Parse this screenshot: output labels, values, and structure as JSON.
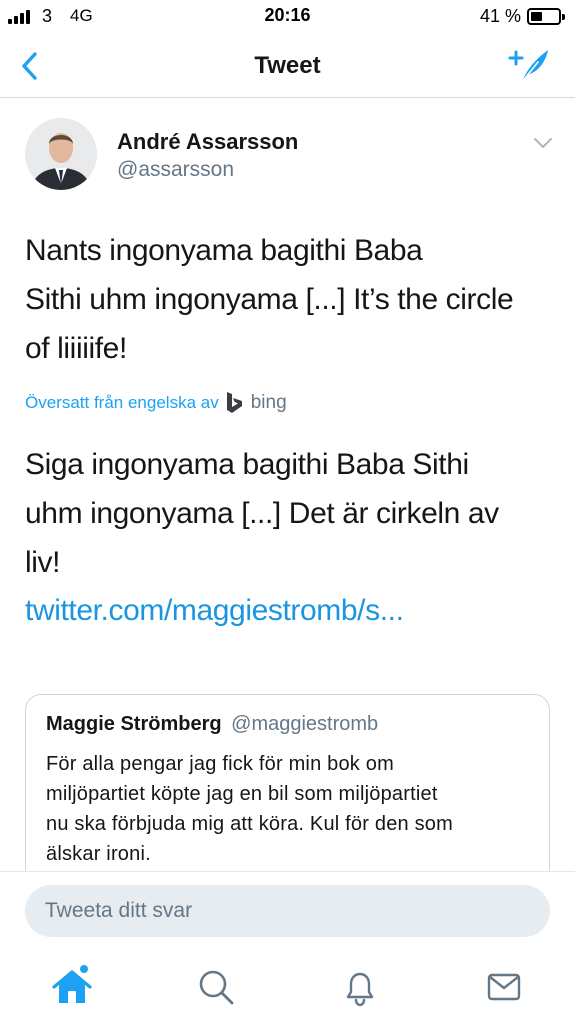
{
  "status_bar": {
    "carrier": "3",
    "network": "4G",
    "time": "20:16",
    "battery_percent": "41 %",
    "battery_level": 0.41
  },
  "nav": {
    "title": "Tweet"
  },
  "tweet": {
    "author_name": "André Assarsson",
    "author_handle": "@assarsson",
    "text_lines": [
      "Nants ingonyama bagithi Baba",
      "Sithi uhm ingonyama [...] It’s the circle",
      "of liiiiife!"
    ],
    "translated_by_label": "Översatt från engelska av",
    "translator_name": "bing",
    "translated_lines": [
      "Siga ingonyama bagithi Baba Sithi",
      "uhm ingonyama [...] Det är cirkeln av",
      "liv!"
    ],
    "link": "twitter.com/maggiestromb/s..."
  },
  "quoted_tweet": {
    "author_name": "Maggie Strömberg",
    "author_handle": "@maggiestromb",
    "text_lines": [
      "För alla pengar jag fick för min bok om",
      "miljöpartiet köpte jag en bil som miljöpartiet",
      "nu ska förbjuda mig att köra. Kul för den som",
      "älskar ironi."
    ]
  },
  "reply": {
    "placeholder": "Tweeta ditt svar"
  },
  "tab_bar": {
    "tabs": [
      {
        "icon": "home-icon",
        "active": true,
        "has_badge": true
      },
      {
        "icon": "search-icon",
        "active": false
      },
      {
        "icon": "bell-icon",
        "active": false
      },
      {
        "icon": "mail-icon",
        "active": false
      }
    ]
  },
  "colors": {
    "accent": "#1da1f2",
    "link": "#1b95e0",
    "secondary_text": "#657786",
    "primary_text": "#14171a",
    "reply_field_bg": "#e6ecf0"
  }
}
